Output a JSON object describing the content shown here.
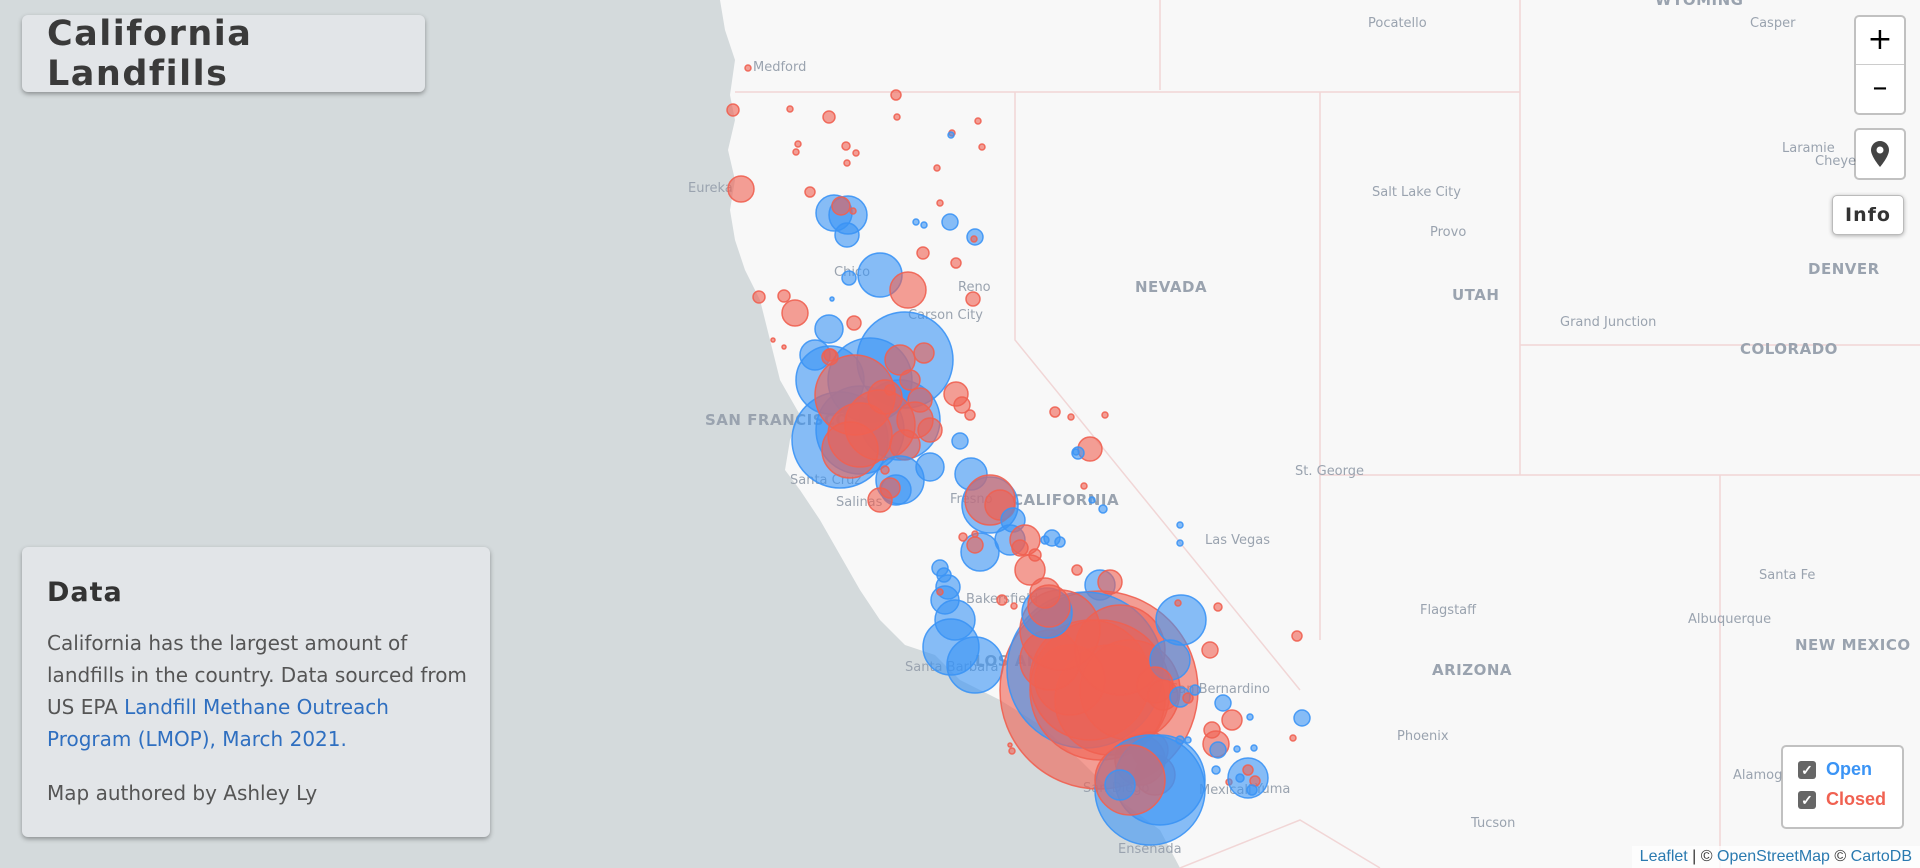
{
  "title": "California Landfills",
  "data_panel": {
    "heading": "Data",
    "desc_before_link": "California has the largest amount of landfills in the country. Data sourced from US EPA ",
    "link_text": "Landfill Methane Outreach Program (LMOP), March 2021.",
    "author": "Map authored by Ashley Ly"
  },
  "controls": {
    "zoom_in": "+",
    "zoom_out": "–",
    "locate_icon": "map-pin-icon",
    "info_label": "Info"
  },
  "legend": {
    "items": [
      {
        "label": "Open",
        "checked": true,
        "color": "#3b94f5"
      },
      {
        "label": "Closed",
        "checked": true,
        "color": "#f06151"
      }
    ]
  },
  "attribution": {
    "leaflet": "Leaflet",
    "sep": " | © ",
    "osm": "OpenStreetMap",
    "copy": " © ",
    "carto": "CartoDB"
  },
  "map_labels": {
    "states": [
      "NEVADA",
      "UTAH",
      "CALIFORNIA",
      "ARIZONA",
      "NEW MEXICO",
      "COLORADO",
      "WYOMING"
    ],
    "cities": [
      "Medford",
      "Eureka",
      "Chico",
      "Reno",
      "Carson City",
      "SAN FRANCISCO",
      "Santa Cruz",
      "Salinas",
      "Fresno",
      "Bakersfield",
      "Santa Barbara",
      "LOS ANGELES",
      "San Bernardino",
      "San Diego",
      "Mexicali",
      "Yuma",
      "Ensenada",
      "Pocatello",
      "Casper",
      "Salt Lake City",
      "Provo",
      "Laramie",
      "Cheyenne",
      "DENVER",
      "Grand Junction",
      "St. George",
      "Las Vegas",
      "Flagstaff",
      "Santa Fe",
      "Albuquerque",
      "Phoenix",
      "Tucson",
      "Alamogordo"
    ]
  },
  "colors": {
    "open": "#3b94f5",
    "closed": "#f06151",
    "ocean": "#d4dadc",
    "land": "#f8f8f8"
  }
}
